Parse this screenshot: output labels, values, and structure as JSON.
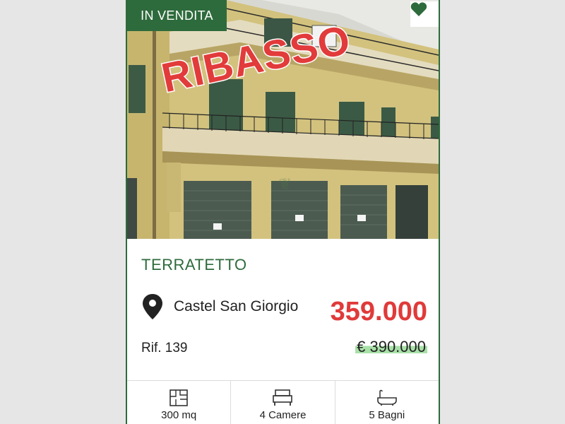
{
  "listing": {
    "status_badge": "IN VENDITA",
    "overlay_text": "RIBASSO",
    "property_type": "TERRATETTO",
    "location": "Castel San Giorgio",
    "price": "359.000",
    "reference": "Rif. 139",
    "old_price": "€ 390.000",
    "favorite_icon": "heart-icon",
    "location_icon": "map-pin-icon"
  },
  "features": [
    {
      "icon": "floorplan-icon",
      "label": "300 mq"
    },
    {
      "icon": "bed-icon",
      "label": "4 Camere"
    },
    {
      "icon": "bathtub-icon",
      "label": "5 Bagni"
    }
  ],
  "colors": {
    "brand_green": "#2e6b3c",
    "price_red": "#e03a3a",
    "highlight_green": "#a8e0a8"
  }
}
